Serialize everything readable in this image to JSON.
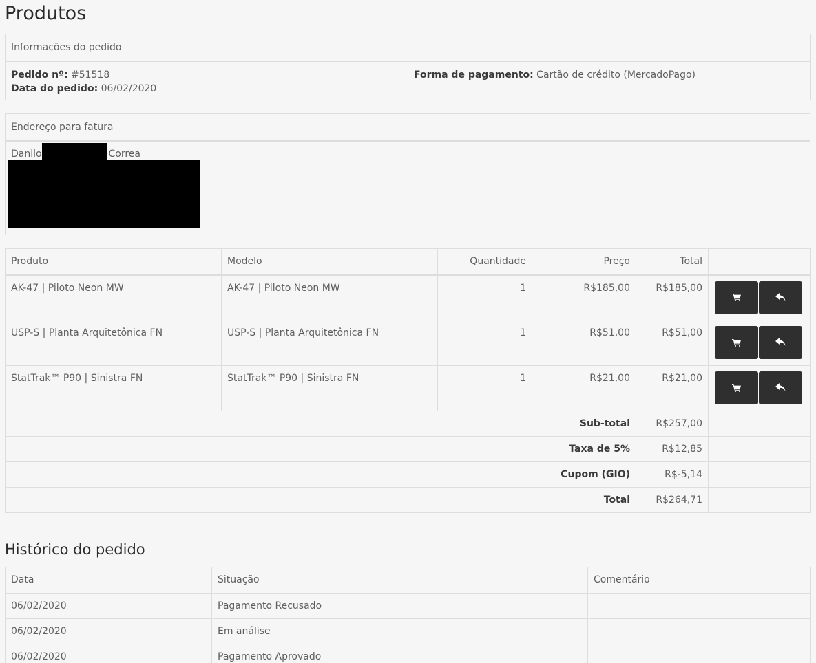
{
  "page": {
    "title": "Produtos"
  },
  "order_info": {
    "header": "Informações do pedido",
    "order_no_label": "Pedido nº:",
    "order_no": "#51518",
    "date_label": "Data do pedido:",
    "date": "06/02/2020",
    "payment_label": "Forma de pagamento:",
    "payment": "Cartão de crédito (MercadoPago)"
  },
  "billing": {
    "header": "Endereço para fatura",
    "first_name": "Danilo",
    "last_name": "Correa"
  },
  "products": {
    "headers": {
      "product": "Produto",
      "model": "Modelo",
      "quantity": "Quantidade",
      "price": "Preço",
      "total": "Total"
    },
    "rows": [
      {
        "product": "AK-47 | Piloto Neon MW",
        "model": "AK-47 | Piloto Neon MW",
        "quantity": "1",
        "price": "R$185,00",
        "total": "R$185,00"
      },
      {
        "product": "USP-S | Planta Arquitetônica FN",
        "model": "USP-S | Planta Arquitetônica FN",
        "quantity": "1",
        "price": "R$51,00",
        "total": "R$51,00"
      },
      {
        "product": "StatTrak™ P90 | Sinistra FN",
        "model": "StatTrak™ P90 | Sinistra FN",
        "quantity": "1",
        "price": "R$21,00",
        "total": "R$21,00"
      }
    ],
    "totals": [
      {
        "label": "Sub-total",
        "value": "R$257,00"
      },
      {
        "label": "Taxa de 5%",
        "value": "R$12,85"
      },
      {
        "label": "Cupom (GIO)",
        "value": "R$-5,14"
      },
      {
        "label": "Total",
        "value": "R$264,71"
      }
    ],
    "icons": {
      "reorder": "cart-icon",
      "return": "reply-icon"
    }
  },
  "history": {
    "title": "Histórico do pedido",
    "headers": {
      "date": "Data",
      "status": "Situação",
      "comment": "Comentário"
    },
    "rows": [
      {
        "date": "06/02/2020",
        "status": "Pagamento Recusado",
        "comment": ""
      },
      {
        "date": "06/02/2020",
        "status": "Em análise",
        "comment": ""
      },
      {
        "date": "06/02/2020",
        "status": "Pagamento Aprovado",
        "comment": ""
      }
    ]
  },
  "colors": {
    "background": "#f6f6f6",
    "border": "#dddddd",
    "button": "#2f2f2f"
  }
}
